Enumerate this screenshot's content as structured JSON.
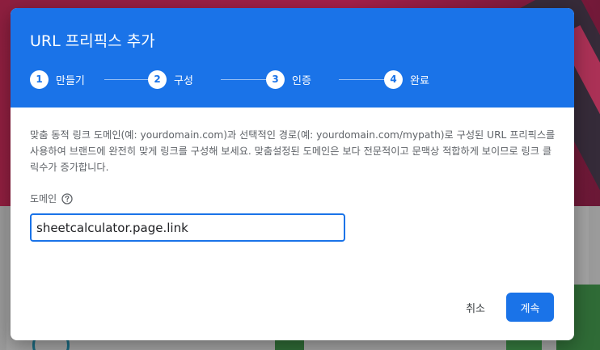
{
  "dialog": {
    "title": "URL 프리픽스 추가",
    "steps": [
      {
        "number": "1",
        "label": "만들기"
      },
      {
        "number": "2",
        "label": "구성"
      },
      {
        "number": "3",
        "label": "인증"
      },
      {
        "number": "4",
        "label": "완료"
      }
    ],
    "description": "맞춤 동적 링크 도메인(예: yourdomain.com)과 선택적인 경로(예: yourdomain.com/mypath)로 구성된 URL 프리픽스를 사용하여 브랜드에 완전히 맞게 링크를 구성해 보세요. 맞춤설정된 도메인은 보다 전문적이고 문맥상 적합하게 보이므로 링크 클릭수가 증가합니다.",
    "domain_field": {
      "label": "도메인",
      "value": "sheetcalculator.page.link",
      "help_icon": "help-circle-icon"
    },
    "actions": {
      "cancel_label": "취소",
      "next_label": "계속"
    }
  },
  "colors": {
    "accent": "#1a73e8",
    "header_text": "#ffffff",
    "body_text": "#5f6368"
  }
}
